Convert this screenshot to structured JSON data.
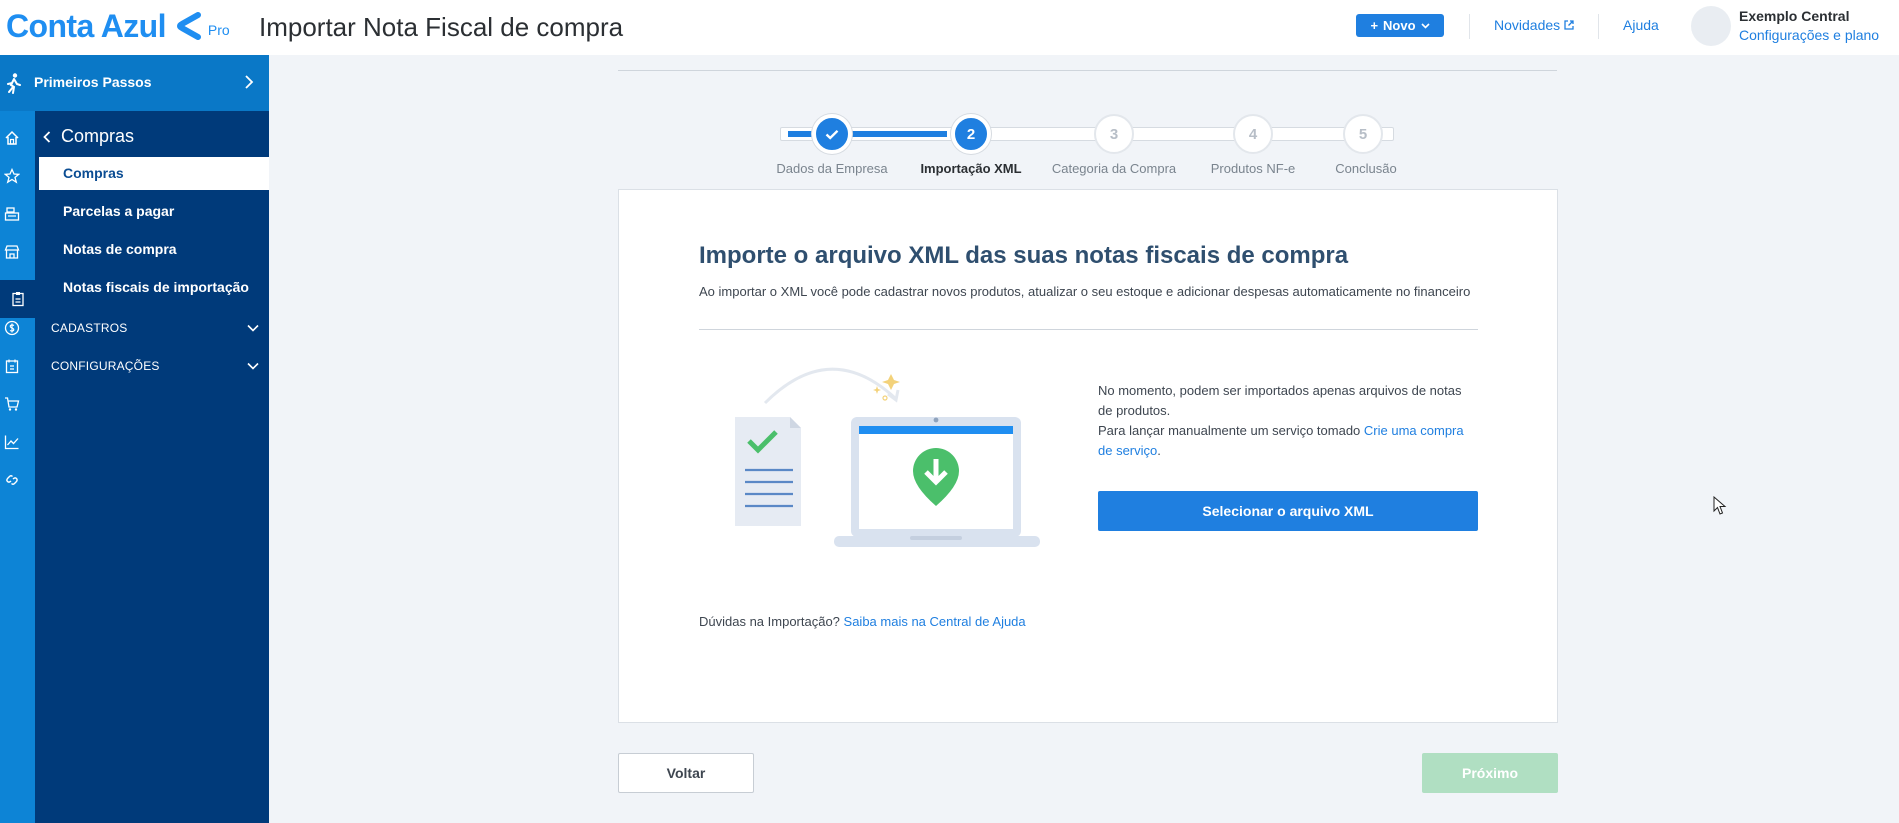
{
  "header": {
    "logo_text": "Conta Azul",
    "logo_badge": "Pro",
    "page_title": "Importar Nota Fiscal de compra",
    "new_button": "Novo",
    "news_link": "Novidades",
    "help_link": "Ajuda",
    "user_name": "Exemplo Central",
    "user_plan_link": "Configurações e plano"
  },
  "sidebar": {
    "first_steps": "Primeiros Passos",
    "section_title": "Compras",
    "items": [
      {
        "label": "Compras",
        "active": true
      },
      {
        "label": "Parcelas a pagar",
        "active": false
      },
      {
        "label": "Notas de compra",
        "active": false
      },
      {
        "label": "Notas fiscais de importação",
        "active": false
      }
    ],
    "groups": [
      {
        "label": "CADASTROS"
      },
      {
        "label": "CONFIGURAÇÕES"
      }
    ],
    "rail_icons": [
      "home-icon",
      "star-icon",
      "cash-register-icon",
      "store-icon",
      "clipboard-icon",
      "dollar-icon",
      "invoice-icon",
      "cart-icon",
      "chart-icon",
      "link-icon"
    ]
  },
  "stepper": {
    "steps": [
      {
        "number": "",
        "label": "Dados da Empresa",
        "state": "done"
      },
      {
        "number": "2",
        "label": "Importação XML",
        "state": "current"
      },
      {
        "number": "3",
        "label": "Categoria da Compra",
        "state": "todo"
      },
      {
        "number": "4",
        "label": "Produtos NF-e",
        "state": "todo"
      },
      {
        "number": "5",
        "label": "Conclusão",
        "state": "todo"
      }
    ]
  },
  "card": {
    "title": "Importe o arquivo XML das suas notas fiscais de compra",
    "description": "Ao importar o XML você pode cadastrar novos produtos, atualizar o seu estoque e adicionar despesas automaticamente no financeiro",
    "info_line1": "No momento, podem ser importados apenas arquivos de notas de produtos.",
    "info_line2": "Para lançar manualmente um serviço tomado ",
    "info_link": "Crie uma compra de serviço",
    "info_end": ".",
    "select_button": "Selecionar o arquivo XML",
    "help_question": "Dúvidas na Importação? ",
    "help_link": "Saiba mais na Central de Ajuda"
  },
  "footer": {
    "back_button": "Voltar",
    "next_button": "Próximo"
  },
  "colors": {
    "brand": "#1f8ef1",
    "primary": "#1f7fe0",
    "nav_dark": "#003a7a",
    "rail": "#0d84d6",
    "success_disabled": "#b0dfc2"
  }
}
